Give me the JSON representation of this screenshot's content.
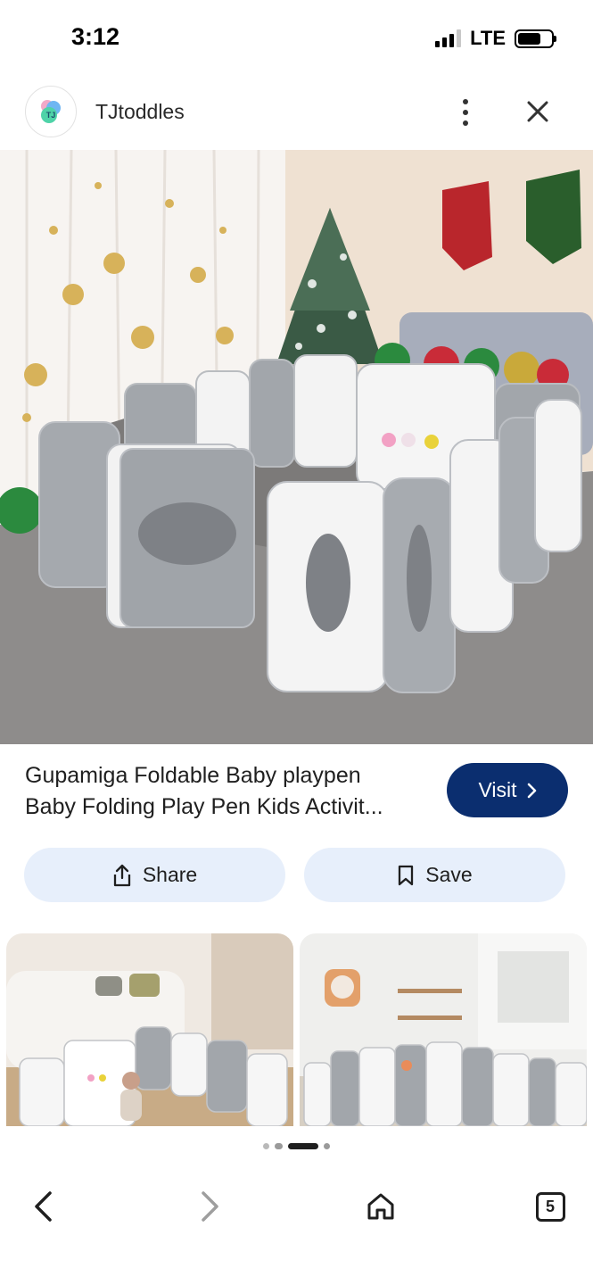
{
  "status_bar": {
    "time": "3:12",
    "network": "LTE"
  },
  "header": {
    "site_name": "TJtoddles",
    "logo_text": "TJ"
  },
  "product": {
    "title_line1": "Gupamiga Foldable Baby playpen",
    "title_line2": "Baby Folding Play Pen Kids Activit...",
    "visit_label": "Visit"
  },
  "actions": {
    "share_label": "Share",
    "save_label": "Save"
  },
  "bottom_nav": {
    "tab_count": "5"
  },
  "colors": {
    "visit_button": "#0b2e6f",
    "pill_background": "#e7effb"
  },
  "icons": {
    "more": "more-vert-icon",
    "close": "close-icon",
    "share": "share-icon",
    "save": "bookmark-icon",
    "back": "chevron-left-icon",
    "forward": "chevron-right-icon",
    "home": "home-icon",
    "tabs": "tabs-icon"
  }
}
